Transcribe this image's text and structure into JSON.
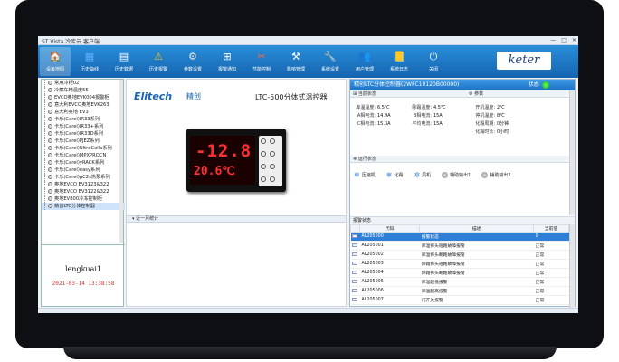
{
  "window": {
    "title": "ST Vista 冷库云 客户端",
    "controls": [
      "—",
      "□",
      "✕"
    ]
  },
  "toolbar": {
    "items": [
      {
        "label": "设备地图",
        "icon": "map-icon",
        "glyph": "🏠",
        "color": "#3a7ec9"
      },
      {
        "label": "历史曲线",
        "icon": "chart-icon",
        "glyph": "▦",
        "color": "#5fb0ff"
      },
      {
        "label": "历史数据",
        "icon": "data-table-icon",
        "glyph": "▤",
        "color": "#ffffff"
      },
      {
        "label": "历史报警",
        "icon": "warning-icon",
        "glyph": "⚠",
        "color": "#f4c21a"
      },
      {
        "label": "参数设置",
        "icon": "gear-icon",
        "glyph": "⚙",
        "color": "#e9e9e9"
      },
      {
        "label": "报警通知",
        "icon": "alarm-notify-icon",
        "glyph": "⊞",
        "color": "#ffffff"
      },
      {
        "label": "节能控制",
        "icon": "tools-icon",
        "glyph": "✂",
        "color": "#ff6a3a"
      },
      {
        "label": "影响管理",
        "icon": "tool-icon",
        "glyph": "⚒",
        "color": "#ffffff"
      },
      {
        "label": "系统设置",
        "icon": "wrench-icon",
        "glyph": "🔧",
        "color": "#eeeeee"
      },
      {
        "label": "用户管理",
        "icon": "users-icon",
        "glyph": "👥",
        "color": "#ffffff"
      },
      {
        "label": "系统日志",
        "icon": "log-icon",
        "glyph": "📒",
        "color": "#ffd35a"
      },
      {
        "label": "关闭",
        "icon": "power-icon",
        "glyph": "⏻",
        "color": "#ffffff"
      }
    ],
    "logo": "keter"
  },
  "tree": {
    "items": [
      "常用冷柜02",
      "冷藏车精温度55",
      "EVCO奥地EVK004报警柜",
      "意大利EVCO奥地EVK263",
      "意大利奥地 EV3",
      "卡乐(Carel)IR33系列",
      "卡乐(Carel)IR33+系列",
      "卡乐(Carel)IR33D系列",
      "卡乐(Carel)PJEZ系列",
      "卡乐(Carel)UltraCella系列",
      "卡乐(Carel)MPXPROCN",
      "卡乐(Carel)yRACK系列",
      "卡乐(Carel)easy系列",
      "卡乐(Carel)μC2s热泵系列",
      "奥地EVCO EV3123&322",
      "奥地EVCO EV3122&322",
      "奥地EV800冷冻控制柜",
      "精创LTC分体控制器"
    ],
    "selected_index": 17
  },
  "user": {
    "name": "lengkuai1",
    "datetime": "2021-03-14 13:38:58"
  },
  "product": {
    "brand": "Elitech",
    "brand_cn": "精创",
    "name": "LTC-500分体式温控器",
    "display_top": "-12.8",
    "display_bottom": "20.6℃",
    "section": "近一月统计"
  },
  "device": {
    "title": "精创LTC分体控制器(2WFC10120B00000)",
    "status_label": "状态:",
    "running_section": "当前状态",
    "params_section": "参数",
    "running_values": [
      {
        "k": "库温温度:",
        "v": "6.5℃"
      },
      {
        "k": "A相电流:",
        "v": "14.9A"
      },
      {
        "k": "C相电流:",
        "v": "15.3A"
      }
    ],
    "running_values2": [
      {
        "k": "除霜温度:",
        "v": "4.5℃"
      },
      {
        "k": "B相电流:",
        "v": "15A"
      },
      {
        "k": "平均电流:",
        "v": "15A"
      }
    ],
    "params": [
      {
        "k": "开机温度:",
        "v": "2℃"
      },
      {
        "k": "停机温度:",
        "v": "8℃"
      },
      {
        "k": "化霜周期:",
        "v": "0分钟"
      },
      {
        "k": "化霜时长:",
        "v": "0小时"
      }
    ],
    "run_status_section": "运行状态",
    "run_status": [
      {
        "label": "压缩机",
        "icon": "snowflake-icon",
        "glyph": "❄"
      },
      {
        "label": "化霜",
        "icon": "defrost-icon",
        "glyph": "❄"
      },
      {
        "label": "风机",
        "icon": "fan-icon",
        "glyph": "✲"
      },
      {
        "label": "辅助输出1",
        "icon": "output1-indicator"
      },
      {
        "label": "辅助输出2",
        "icon": "output2-indicator"
      }
    ],
    "alarm_section": "报警状态",
    "alarm_columns": [
      "代码",
      "描述",
      "当前值"
    ],
    "alarms": [
      {
        "code": "AL205000",
        "desc": "报警状态",
        "val": "0"
      },
      {
        "code": "AL205001",
        "desc": "库温探头短路故障报警",
        "val": "正常"
      },
      {
        "code": "AL205002",
        "desc": "库温探头断路故障报警",
        "val": "正常"
      },
      {
        "code": "AL205003",
        "desc": "除霜探头短路故障报警",
        "val": "正常"
      },
      {
        "code": "AL205004",
        "desc": "除霜探头断路故障报警",
        "val": "正常"
      },
      {
        "code": "AL205005",
        "desc": "库温超低报警",
        "val": "正常"
      },
      {
        "code": "AL205006",
        "desc": "库温超高报警",
        "val": "正常"
      },
      {
        "code": "AL205007",
        "desc": "门开关报警",
        "val": "正常"
      }
    ],
    "selected_alarm": 0
  }
}
